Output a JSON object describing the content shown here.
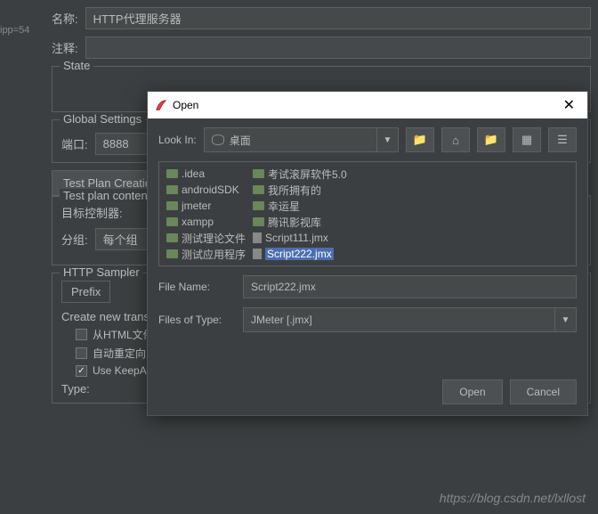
{
  "side_text": "ipp=54",
  "form": {
    "name_label": "名称:",
    "name_value": "HTTP代理服务器",
    "comment_label": "注释:",
    "comment_value": ""
  },
  "state": {
    "legend": "State"
  },
  "global": {
    "legend": "Global Settings",
    "port_label": "端口:",
    "port_value": "8888"
  },
  "testplan": {
    "tab": "Test Plan Creation",
    "content_legend": "Test plan content",
    "target_label": "目标控制器:",
    "group_label": "分组:",
    "group_value": "每个组"
  },
  "sampler": {
    "legend": "HTTP Sampler",
    "prefix_label": "Prefix",
    "create_label": "Create new transaction",
    "chk_html": "从HTML文件",
    "chk_redirect": "自动重定向",
    "chk_keepalive": "Use KeepAlive",
    "type_label": "Type:"
  },
  "dialog": {
    "title": "Open",
    "lookin_label": "Look In:",
    "lookin_value": "桌面",
    "filename_label": "File Name:",
    "filename_value": "Script222.jmx",
    "filetype_label": "Files of Type:",
    "filetype_value": "JMeter [.jmx]",
    "open_btn": "Open",
    "cancel_btn": "Cancel",
    "files": [
      {
        "name": ".idea",
        "type": "folder"
      },
      {
        "name": "androidSDK",
        "type": "folder"
      },
      {
        "name": "jmeter",
        "type": "folder"
      },
      {
        "name": "xampp",
        "type": "folder"
      },
      {
        "name": "测试理论文件",
        "type": "folder"
      },
      {
        "name": "测试应用程序",
        "type": "folder"
      },
      {
        "name": "考试滚屏软件5.0",
        "type": "folder"
      },
      {
        "name": "我所拥有的",
        "type": "folder"
      },
      {
        "name": "幸运星",
        "type": "folder"
      },
      {
        "name": "腾讯影视库",
        "type": "folder"
      },
      {
        "name": "Script111.jmx",
        "type": "file"
      },
      {
        "name": "Script222.jmx",
        "type": "file",
        "selected": true
      }
    ]
  },
  "watermark": "https://blog.csdn.net/lxllost"
}
